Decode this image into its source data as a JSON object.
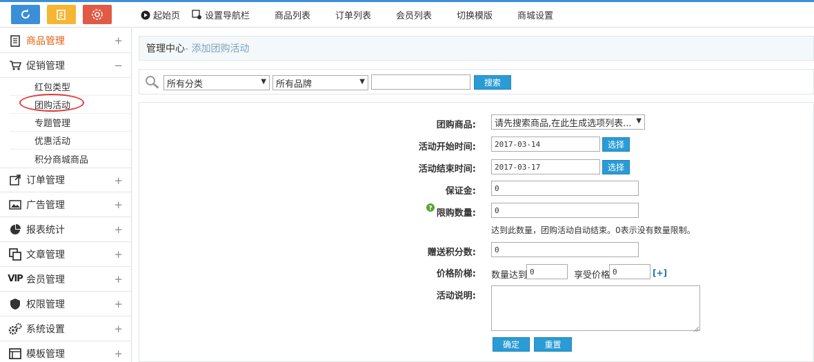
{
  "topbar": {
    "nav": [
      {
        "label": "起始页",
        "icon": "play-circle-icon"
      },
      {
        "label": "设置导航栏",
        "icon": "settings-square-icon"
      },
      {
        "label": "商品列表"
      },
      {
        "label": "订单列表"
      },
      {
        "label": "会员列表"
      },
      {
        "label": "切换模版"
      },
      {
        "label": "商城设置"
      }
    ]
  },
  "sidebar": {
    "menus": [
      {
        "label": "商品管理",
        "toggle": "+"
      },
      {
        "label": "促销管理",
        "toggle": "−"
      },
      {
        "label": "订单管理",
        "toggle": "+"
      },
      {
        "label": "广告管理",
        "toggle": "+"
      },
      {
        "label": "报表统计",
        "toggle": "+"
      },
      {
        "label": "文章管理",
        "toggle": "+"
      },
      {
        "label": "会员管理",
        "toggle": "+"
      },
      {
        "label": "权限管理",
        "toggle": "+"
      },
      {
        "label": "系统设置",
        "toggle": "+"
      },
      {
        "label": "模板管理",
        "toggle": "+"
      }
    ],
    "promo_subitems": [
      "红包类型",
      "团购活动",
      "专题管理",
      "优惠活动",
      "积分商城商品"
    ],
    "vip_glyph": "VIP"
  },
  "page": {
    "heading_main": "管理中心",
    "heading_sub": "- 添加团购活动"
  },
  "search": {
    "category": "所有分类",
    "brand": "所有品牌",
    "keyword": "",
    "button": "搜索"
  },
  "form": {
    "goods_label": "团购商品:",
    "goods_value": "请先搜索商品,在此生成选项列表...",
    "start_label": "活动开始时间:",
    "start_value": "2017-03-14",
    "end_label": "活动结束时间:",
    "end_value": "2017-03-17",
    "pick_button": "选择",
    "deposit_label": "保证金:",
    "deposit_value": "0",
    "limit_label": "限购数量:",
    "limit_value": "0",
    "limit_note": "达到此数量，团购活动自动结束。0表示没有数量限制。",
    "points_label": "赠送积分数:",
    "points_value": "0",
    "price_label": "价格阶梯:",
    "qty_text": "数量达到",
    "qty_value": "0",
    "price_text": "享受价格",
    "price_value": "0",
    "add_tier": "[+]",
    "desc_label": "活动说明:",
    "desc_value": "",
    "confirm_button": "确定",
    "reset_button": "重置"
  },
  "colors": {
    "accent_blue": "#2a9bd5",
    "active_orange": "#e4600f",
    "highlight_red": "#e23a3a"
  }
}
